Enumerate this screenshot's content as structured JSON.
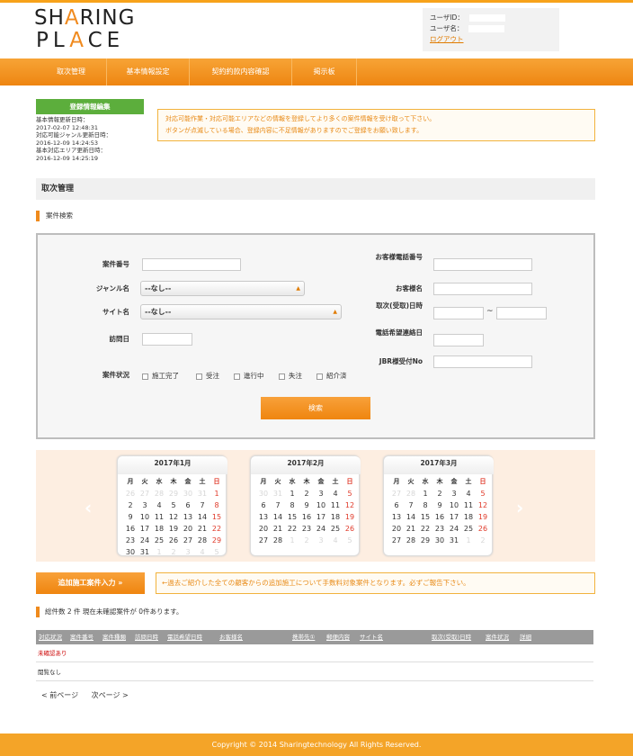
{
  "header": {
    "logo_line1": "SHARING",
    "logo_line2": "PLACE",
    "user_id_label": "ユーザID：",
    "user_name_label": "ユーザ名：",
    "logout": "ログアウト"
  },
  "nav": [
    "取次管理",
    "基本情報設定",
    "契約約款内容確認",
    "掲示板"
  ],
  "registration": {
    "button": "登録情報編集",
    "lines": [
      "基本情報更新日時：",
      "2017-02-07 12:48:31",
      "対応可能ジャンル更新日時：",
      "2016-12-09 14:24:53",
      "基本対応エリア更新日時：",
      "2016-12-09 14:25:19"
    ]
  },
  "notice": [
    "対応可能作業・対応可能エリアなどの情報を登録してより多くの案件情報を受け取って下さい。",
    "ボタンが点滅している場合、登録内容に不足情報がありますのでご登録をお願い致します。"
  ],
  "section_title": "取次管理",
  "search_section": "案件検索",
  "form": {
    "case_no": "案件番号",
    "genre": "ジャンル名",
    "site": "サイト名",
    "visit_date": "訪問日",
    "status": "案件状況",
    "genre_value": "--なし--",
    "site_value": "--なし--",
    "phone": "お客様電話番号",
    "customer": "お客様名",
    "order_date": "取次(受取)日時",
    "callback": "電話希望連絡日",
    "jbr": "JBR様受付No",
    "tilde": "~",
    "statuses": [
      "施工完了",
      "受注",
      "進行中",
      "失注",
      "紹介済"
    ],
    "search_button": "検索"
  },
  "calendars": [
    {
      "title": "2017年1月",
      "days": [
        [
          "26",
          "27",
          "28",
          "29",
          "30",
          "31",
          "1"
        ],
        [
          "2",
          "3",
          "4",
          "5",
          "6",
          "7",
          "8"
        ],
        [
          "9",
          "10",
          "11",
          "12",
          "13",
          "14",
          "15"
        ],
        [
          "16",
          "17",
          "18",
          "19",
          "20",
          "21",
          "22"
        ],
        [
          "23",
          "24",
          "25",
          "26",
          "27",
          "28",
          "29"
        ],
        [
          "30",
          "31",
          "1",
          "2",
          "3",
          "4",
          "5"
        ]
      ]
    },
    {
      "title": "2017年2月",
      "days": [
        [
          "30",
          "31",
          "1",
          "2",
          "3",
          "4",
          "5"
        ],
        [
          "6",
          "7",
          "8",
          "9",
          "10",
          "11",
          "12"
        ],
        [
          "13",
          "14",
          "15",
          "16",
          "17",
          "18",
          "19"
        ],
        [
          "20",
          "21",
          "22",
          "23",
          "24",
          "25",
          "26"
        ],
        [
          "27",
          "28",
          "1",
          "2",
          "3",
          "4",
          "5"
        ]
      ]
    },
    {
      "title": "2017年3月",
      "days": [
        [
          "27",
          "28",
          "1",
          "2",
          "3",
          "4",
          "5"
        ],
        [
          "6",
          "7",
          "8",
          "9",
          "10",
          "11",
          "12"
        ],
        [
          "13",
          "14",
          "15",
          "16",
          "17",
          "18",
          "19"
        ],
        [
          "20",
          "21",
          "22",
          "23",
          "24",
          "25",
          "26"
        ],
        [
          "27",
          "28",
          "29",
          "30",
          "31",
          "1",
          "2"
        ]
      ]
    }
  ],
  "weekdays": [
    "月",
    "火",
    "水",
    "木",
    "金",
    "土",
    "日"
  ],
  "add_button": "追加施工案件入力 »",
  "add_note": "←過去ご紹介した全ての顧客からの追加施工について手数料対象案件となります。必ずご報告下さい。",
  "count_text": "総件数 2 件 現在未確認案件が 0件あります。",
  "table": {
    "headers": [
      "対応状況",
      "案件番号",
      "案件種類",
      "訪問日時",
      "電話希望日時",
      "お客様名",
      "",
      "携帯先①",
      "郵便内容",
      "サイト名",
      "取次(受取)日時",
      "案件状況",
      "詳細"
    ],
    "rows": [
      [
        "未確認あり"
      ],
      [
        "閲覧なし"
      ]
    ]
  },
  "pager": {
    "prev": "< 前ページ",
    "next": "次ページ >"
  },
  "footer": "Copyright © 2014 Sharingtechnology All Rights Reserved."
}
